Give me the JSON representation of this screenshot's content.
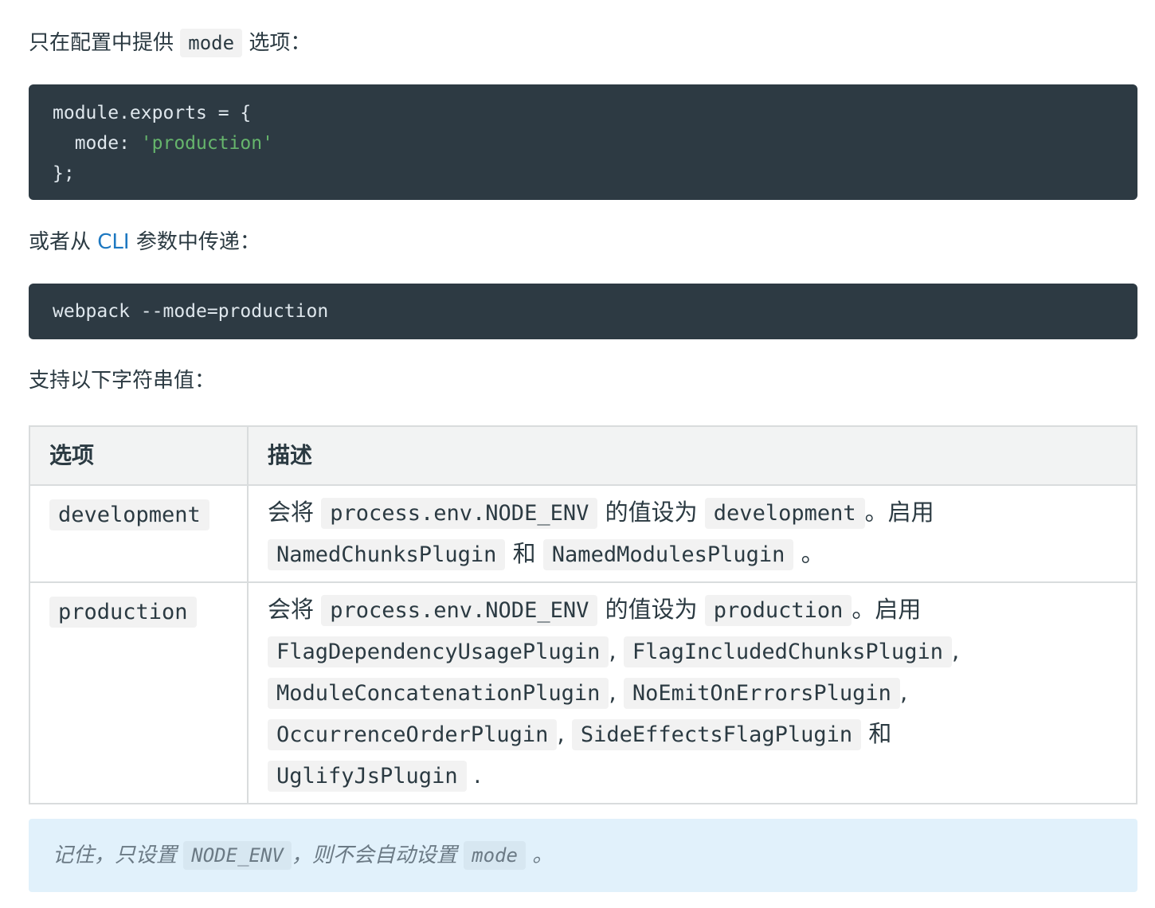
{
  "intro_config": {
    "before": "只在配置中提供",
    "code": "mode",
    "after": "选项："
  },
  "config_code": {
    "line1_ident": "module.exports",
    "line1_rest": " = {",
    "line2_key": "  mode: ",
    "line2_value": "'production'",
    "line3": "};"
  },
  "intro_cli": {
    "before": "或者从 ",
    "link": "CLI",
    "after": " 参数中传递："
  },
  "cli_code": "webpack --mode=production",
  "intro_values": "支持以下字符串值：",
  "table": {
    "headers": [
      "选项",
      "描述"
    ],
    "rows": [
      {
        "option": "development",
        "desc": {
          "t1": "会将",
          "c1": "process.env.NODE_ENV",
          "t2": "的值设为",
          "c2": "development",
          "t3": "。启用",
          "c3": "NamedChunksPlugin",
          "t4": "和",
          "c4": "NamedModulesPlugin",
          "t5": "。"
        }
      },
      {
        "option": "production",
        "desc": {
          "t1": "会将",
          "c1": "process.env.NODE_ENV",
          "t2": "的值设为",
          "c2": "production",
          "t3": "。启用",
          "c3": "FlagDependencyUsagePlugin",
          "s1": ",",
          "c4": "FlagIncludedChunksPlugin",
          "s2": ",",
          "c5": "ModuleConcatenationPlugin",
          "s3": ",",
          "c6": "NoEmitOnErrorsPlugin",
          "s4": ",",
          "c7": "OccurrenceOrderPlugin",
          "s5": ",",
          "c8": "SideEffectsFlagPlugin",
          "t4": "和",
          "c9": "UglifyJsPlugin",
          "t5": "."
        }
      }
    ]
  },
  "note": {
    "t1": "记住，只设置",
    "c1": "NODE_ENV",
    "t2": "，则不会自动设置",
    "c2": "mode",
    "t3": "。"
  }
}
